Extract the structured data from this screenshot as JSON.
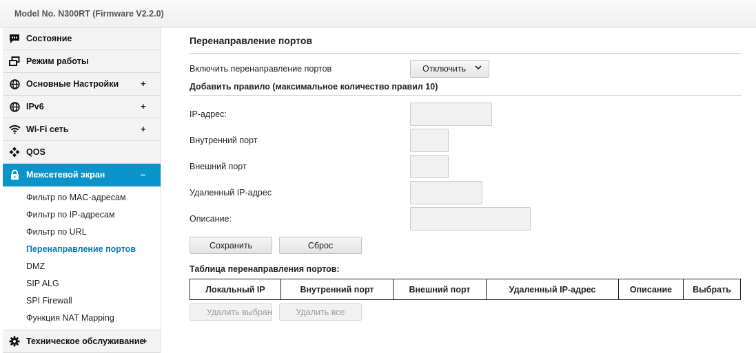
{
  "header": {
    "model": "Model No. N300RT (Firmware V2.2.0)"
  },
  "sidebar": {
    "items": [
      {
        "label": "Состояние",
        "sign": ""
      },
      {
        "label": "Режим работы",
        "sign": ""
      },
      {
        "label": "Основные Настройки",
        "sign": "+"
      },
      {
        "label": "IPv6",
        "sign": "+"
      },
      {
        "label": "Wi-Fi сеть",
        "sign": "+"
      },
      {
        "label": "QOS",
        "sign": ""
      },
      {
        "label": "Межсетевой экран",
        "sign": "–"
      }
    ],
    "subitems": [
      "Фильтр по MAC-адресам",
      "Фильтр по IP-адресам",
      "Фильтр по URL",
      "Перенаправление портов",
      "DMZ",
      "SIP ALG",
      "SPI Firewall",
      "Функция NAT Mapping"
    ],
    "last_item": {
      "label": "Техническое обслуживание",
      "sign": "+"
    }
  },
  "main": {
    "title": "Перенаправление портов",
    "enable_label": "Включить перенаправление портов",
    "enable_value": "Отключить",
    "add_rule_title": "Добавить правило (максимальное количество правил 10)",
    "fields": {
      "ip": {
        "label": "IP-адрес:",
        "value": ""
      },
      "internal_port": {
        "label": "Внутренний порт",
        "value": ""
      },
      "external_port": {
        "label": "Внешний порт",
        "value": ""
      },
      "remote_ip": {
        "label": "Удаленный IP-адрес",
        "value": ""
      },
      "description": {
        "label": "Описание:",
        "value": ""
      }
    },
    "save_label": "Сохранить",
    "reset_label": "Сброс",
    "table_title": "Таблица перенаправления портов:",
    "table_headers": [
      "Локальный IP",
      "Внутренний порт",
      "Внешний порт",
      "Удаленный IP-адрес",
      "Описание",
      "Выбрать"
    ],
    "delete_selected_label": "Удалить выбранн",
    "delete_all_label": "Удалить все"
  },
  "colors": {
    "accent": "#0a94c9",
    "active_link": "#0a7ab5"
  },
  "icons": {
    "status": "chat-icon",
    "mode": "windows-icon",
    "basic": "globe-icon",
    "ipv6": "globe-icon",
    "wifi": "wifi-icon",
    "qos": "diamond-cluster-icon",
    "firewall": "lock-icon",
    "maintenance": "gear-icon"
  }
}
